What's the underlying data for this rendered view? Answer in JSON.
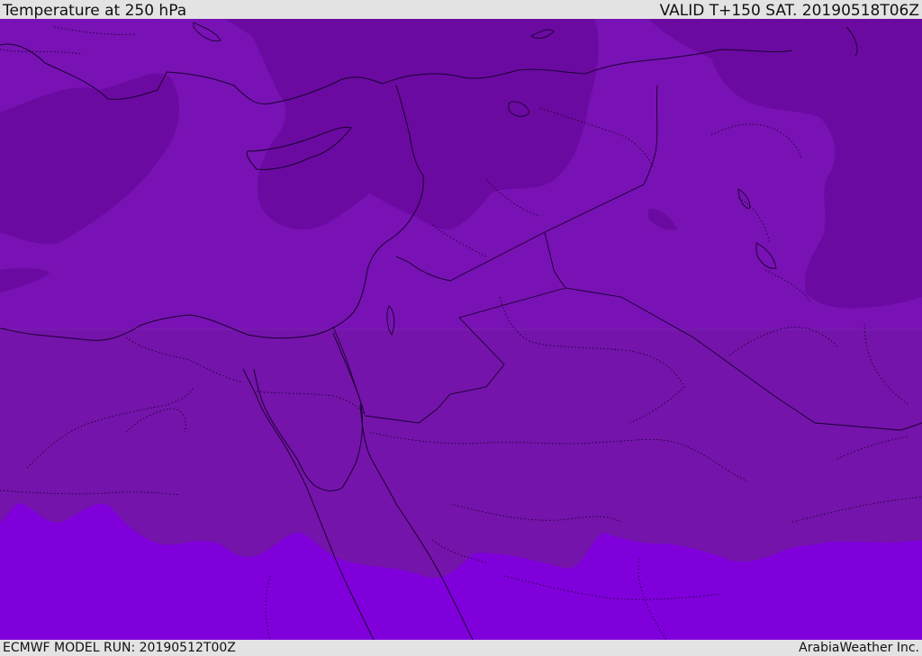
{
  "header": {
    "title": "Temperature at 250 hPa",
    "valid": "VALID T+150 SAT. 20190518T06Z"
  },
  "footer": {
    "model_run": "ECMWF MODEL RUN: 20190512T00Z",
    "credit": "ArabiaWeather Inc."
  },
  "map": {
    "type": "temperature contour map",
    "colors": {
      "band_cold": "#6a0aa0",
      "band_mid": "#7812b4",
      "band_warm_south": "#7414aa",
      "band_hottest": "#8000dc",
      "coast": "#1a0030"
    }
  }
}
